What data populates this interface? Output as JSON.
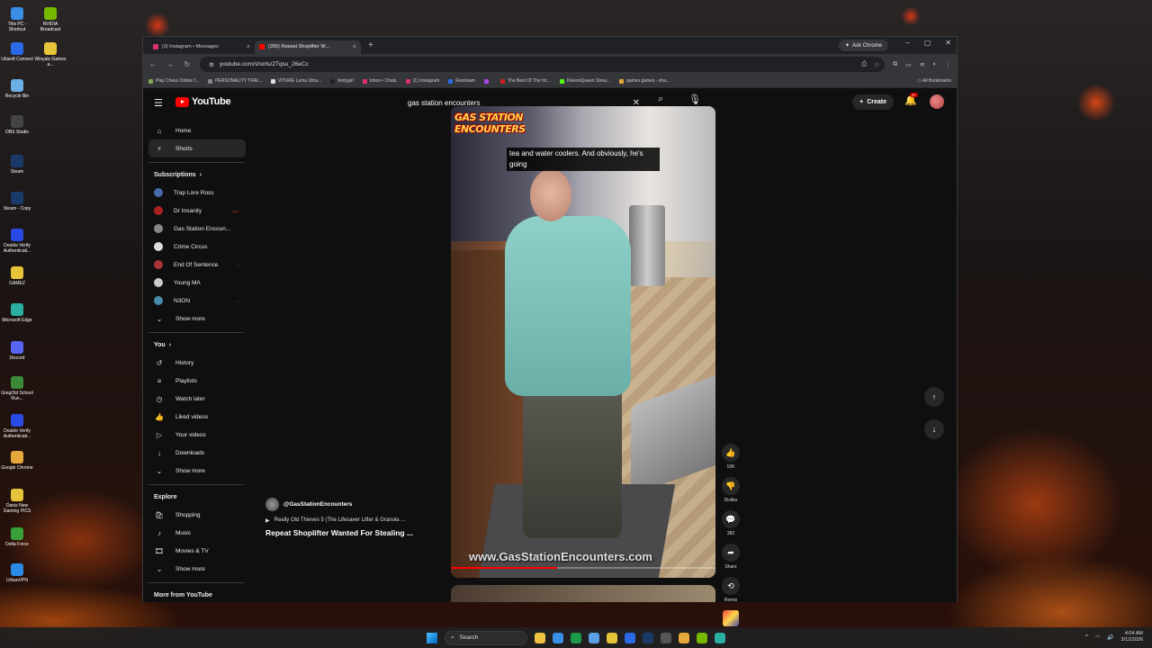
{
  "desktop": {
    "icons": [
      {
        "label": "This PC - Shortcut",
        "color": "#3a8ee6"
      },
      {
        "label": "Ubisoft Connect",
        "color": "#2a6ae6"
      },
      {
        "label": "Recycle Bin",
        "color": "#6ab0e6"
      },
      {
        "label": "OBS Studio",
        "color": "#444444"
      },
      {
        "label": "Steam",
        "color": "#1a3a6a"
      },
      {
        "label": "Steam - Copy",
        "color": "#1a3a6a"
      },
      {
        "label": "Double Verify Authenticati...",
        "color": "#2a4ae6"
      },
      {
        "label": "GAMEZ",
        "color": "#e6c43a"
      },
      {
        "label": "Microsoft Edge",
        "color": "#2ab0a0"
      },
      {
        "label": "Discord",
        "color": "#5865f2"
      },
      {
        "label": "GregOld School Run...",
        "color": "#3a8a3a"
      },
      {
        "label": "Double Verify Authenticati...",
        "color": "#2a4ae6"
      },
      {
        "label": "Google Chrome",
        "color": "#e6a83a"
      },
      {
        "label": "Danis New Gaming PICS",
        "color": "#e6c43a"
      },
      {
        "label": "Delta Force",
        "color": "#3aa03a"
      },
      {
        "label": "UrbanVPN",
        "color": "#2a8ae6"
      }
    ],
    "icons_col2": [
      {
        "label": "NVIDIA Broadcast",
        "color": "#76b900"
      },
      {
        "label": "Winyals Games a...",
        "color": "#e6c43a"
      }
    ]
  },
  "browser": {
    "tabs": [
      {
        "label": "(3) Instagram • Messages",
        "active": false,
        "color": "#e1306c"
      },
      {
        "label": "(265) Repeat Shoplifter W...",
        "active": true,
        "color": "#ff0000"
      }
    ],
    "ask_chrome": "Ask Chrome",
    "url": "youtube.com/shorts/2Tqsu_26eCc",
    "bookmarks": [
      {
        "label": "Play Chess Online f...",
        "color": "#7fa650"
      },
      {
        "label": "PERSONALITY TRAI...",
        "color": "#888888"
      },
      {
        "label": "VITURE Luma Ultra...",
        "color": "#dddddd"
      },
      {
        "label": "fentygirl",
        "color": "#222222"
      },
      {
        "label": "Inbox • Chats",
        "color": "#e1306c"
      },
      {
        "label": "(1) Instagram",
        "color": "#e1306c"
      },
      {
        "label": "Restream",
        "color": "#2a6ae6"
      },
      {
        "label": "",
        "color": "#aa44ee"
      },
      {
        "label": "The Best Of The Int...",
        "color": "#cc2222"
      },
      {
        "label": "DeleonQueen Strea...",
        "color": "#53fc18"
      },
      {
        "label": "games games - sha...",
        "color": "#e6a83a"
      }
    ],
    "all_bookmarks": "All Bookmarks"
  },
  "youtube": {
    "logo_text": "YouTube",
    "search_value": "gas station encounters",
    "create_label": "Create",
    "notif_badge": "9+",
    "sidebar": {
      "main": [
        {
          "label": "Home",
          "icon": "⌂",
          "active": false
        },
        {
          "label": "Shorts",
          "icon": "⚡",
          "active": true
        }
      ],
      "subscriptions_title": "Subscriptions",
      "subscriptions": [
        {
          "label": "Trap Lore Ross",
          "color": "#4a6aaa",
          "live": ""
        },
        {
          "label": "Dr Insanity",
          "color": "#aa2222",
          "live": "red"
        },
        {
          "label": "Gas Station Encoun...",
          "color": "#888888",
          "live": ""
        },
        {
          "label": "Crime Circus",
          "color": "#dddddd",
          "live": ""
        },
        {
          "label": "End Of Sentence",
          "color": "#aa3333",
          "live": "green"
        },
        {
          "label": "Young MA",
          "color": "#cccccc",
          "live": ""
        },
        {
          "label": "N3ON",
          "color": "#4a8aaa",
          "live": "green"
        }
      ],
      "show_more": "Show more",
      "you_title": "You",
      "you_items": [
        {
          "label": "History",
          "icon": "↺"
        },
        {
          "label": "Playlists",
          "icon": "≡"
        },
        {
          "label": "Watch later",
          "icon": "◷"
        },
        {
          "label": "Liked videos",
          "icon": "👍"
        },
        {
          "label": "Your videos",
          "icon": "▷"
        },
        {
          "label": "Downloads",
          "icon": "↓"
        }
      ],
      "explore_title": "Explore",
      "explore_items": [
        {
          "label": "Shopping",
          "icon": "🛍"
        },
        {
          "label": "Music",
          "icon": "♪"
        },
        {
          "label": "Movies & TV",
          "icon": "🎞"
        }
      ],
      "more_from": "More from YouTube"
    },
    "short": {
      "channel_logo_line1": "GAS STATION",
      "channel_logo_line2": "ENCOUNTERS",
      "caption": "tea and water coolers. And obviously, he's going",
      "watermark": "www.GasStationEncounters.com",
      "progress": 0.4,
      "channel_handle": "@GasStationEncounters",
      "song": "Really Old Thieves 5 (The Lifesaver Lifter & Granola ...",
      "title": "Repeat Shoplifter Wanted For Stealing ..."
    },
    "actions": [
      {
        "name": "like",
        "icon": "👍",
        "label": "10K"
      },
      {
        "name": "dislike",
        "icon": "👎",
        "label": "Dislike"
      },
      {
        "name": "comments",
        "icon": "💬",
        "label": "382"
      },
      {
        "name": "share",
        "icon": "➦",
        "label": "Share"
      },
      {
        "name": "remix",
        "icon": "⟲",
        "label": "Remix"
      }
    ]
  },
  "taskbar": {
    "search_label": "Search",
    "apps": [
      "#f0c040",
      "#3a8ee6",
      "#1a9a4a",
      "#5aa0e6",
      "#e6c43a",
      "#2a6ae6",
      "#1a3a6a",
      "#555555",
      "#e6a83a",
      "#76b900",
      "#2ab0a0"
    ],
    "time": "4:04 AM",
    "date": "3/12/2026"
  }
}
